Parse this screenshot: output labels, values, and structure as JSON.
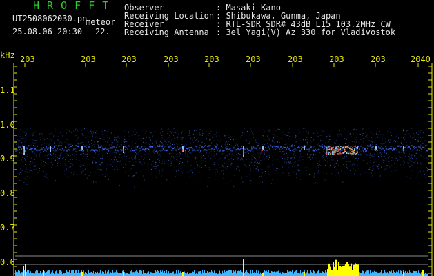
{
  "app": {
    "title": "H R O F F T",
    "filename": "UT2508062030.pn",
    "meteor_label": "meteor",
    "datetime": "25.08.06 20:30",
    "count": "22."
  },
  "info": {
    "observer_label": "Observer",
    "observer_value": ": Masaki Kano",
    "location_label": "Receiving Location",
    "location_value": ": Shibukawa, Gunma, Japan",
    "receiver_label": "Receiver",
    "receiver_value": ": RTL-SDR SDR# 43dB L15 103.2MHz CW",
    "antenna_label": "Receiving Antenna",
    "antenna_value": ": 3el Yagi(V) Az 330 for Vladivostok"
  },
  "axis": {
    "unit": "kHz",
    "y_ticks": [
      "1.1",
      "1.0",
      "0.9",
      "0.8",
      "0.7",
      "0.6"
    ],
    "x_ticks": [
      "203",
      "203",
      "203",
      "203",
      "203",
      "203",
      "203",
      "203",
      "203",
      "2040"
    ]
  },
  "colors": {
    "background": "#000000",
    "title": "#2ecc2e",
    "text": "#e6e6e6",
    "axis": "#e8e800",
    "signal": "#4a7bff",
    "echo": "#ff4040"
  }
}
